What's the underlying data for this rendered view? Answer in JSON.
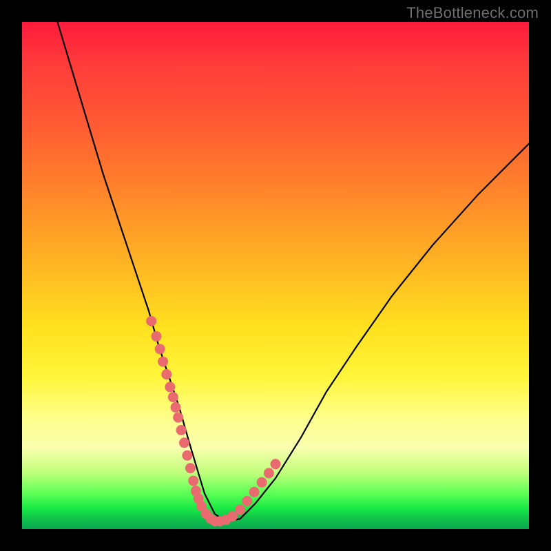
{
  "watermark": "TheBottleneck.com",
  "colors": {
    "frame": "#000000",
    "curve": "#000000",
    "dots": "#e96a6f"
  },
  "chart_data": {
    "type": "line",
    "title": "",
    "xlabel": "",
    "ylabel": "",
    "xlim": [
      0,
      100
    ],
    "ylim": [
      0,
      100
    ],
    "grid": false,
    "legend": false,
    "series": [
      {
        "name": "bottleneck-curve",
        "x": [
          7,
          10,
          13,
          16,
          19,
          22,
          25,
          27,
          29,
          31,
          33,
          34.5,
          36,
          38,
          40,
          43,
          46,
          50,
          55,
          60,
          66,
          73,
          81,
          90,
          100
        ],
        "y": [
          100,
          90,
          80,
          70,
          61,
          52,
          43,
          36,
          30,
          24,
          17,
          12,
          7,
          3,
          1.5,
          2,
          5,
          10,
          18,
          27,
          36,
          46,
          56,
          66,
          76
        ]
      }
    ],
    "annotations": {
      "highlight_dots": {
        "comment": "salmon dots along lower portion of curve where bottleneck percentage is small",
        "x": [
          25.5,
          26.5,
          27.2,
          27.8,
          28.5,
          29.2,
          29.8,
          30.3,
          30.8,
          31.4,
          32.0,
          32.6,
          33.2,
          33.8,
          34.3,
          34.8,
          35.4,
          36.3,
          37.2,
          38.1,
          39.0,
          40.2,
          41.5,
          43.0,
          44.4,
          45.8,
          47.3,
          48.7,
          50.0
        ],
        "y": [
          41,
          38,
          35.5,
          33,
          30.5,
          28,
          26,
          24,
          22,
          19.5,
          17,
          14.5,
          12,
          9.5,
          7.5,
          6,
          4.5,
          3.0,
          2.0,
          1.5,
          1.5,
          1.8,
          2.5,
          3.8,
          5.5,
          7.3,
          9.2,
          11.0,
          12.8
        ]
      }
    }
  }
}
